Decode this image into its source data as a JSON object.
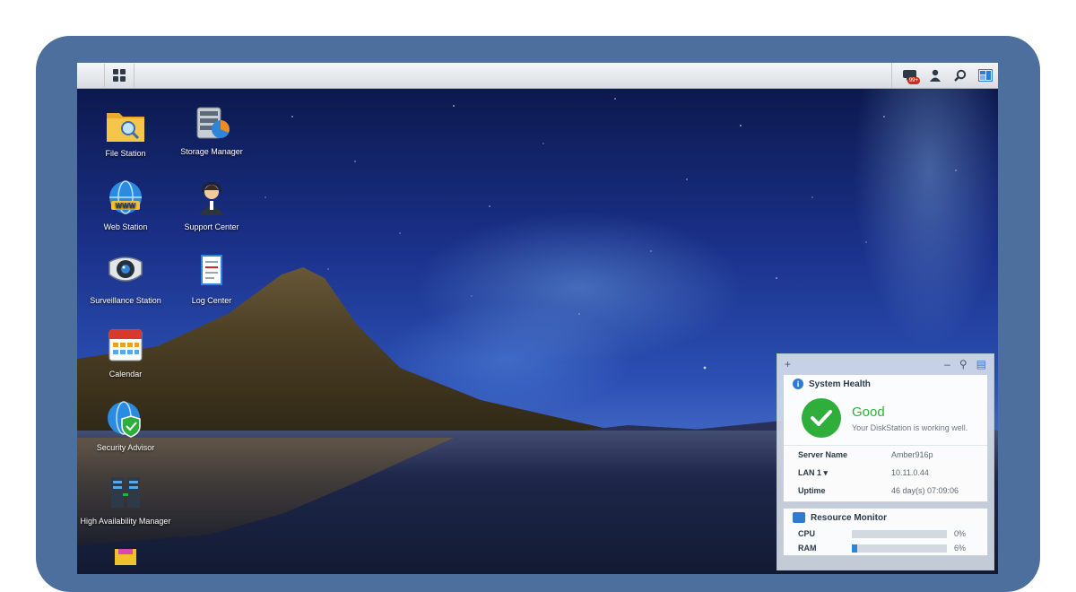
{
  "taskbar": {
    "main_menu_icon": "grid-icon",
    "right_icons": [
      "chat-notification-icon",
      "user-icon",
      "search-icon",
      "widgets-icon"
    ],
    "notification_badge": "99+"
  },
  "desktop": {
    "icons": [
      {
        "label": "File Station",
        "icon": "folder-search-icon"
      },
      {
        "label": "Storage Manager",
        "icon": "storage-icon"
      },
      {
        "label": "Web Station",
        "icon": "globe-icon"
      },
      {
        "label": "Support Center",
        "icon": "support-person-icon"
      },
      {
        "label": "Surveillance Station",
        "icon": "camera-icon"
      },
      {
        "label": "Log Center",
        "icon": "log-document-icon"
      },
      {
        "label": "Calendar",
        "icon": "calendar-icon"
      },
      {
        "label": "Security Advisor",
        "icon": "shield-globe-icon"
      },
      {
        "label": "High Availability Manager",
        "icon": "servers-icon"
      }
    ]
  },
  "widgets": {
    "system_health": {
      "title": "System Health",
      "status": "Good",
      "status_detail": "Your DiskStation is working well.",
      "rows": [
        {
          "key": "Server Name",
          "value": "Amber916p"
        },
        {
          "key": "LAN 1 ▾",
          "value": "10.11.0.44"
        },
        {
          "key": "Uptime",
          "value": "46 day(s) 07:09:06"
        }
      ]
    },
    "resource_monitor": {
      "title": "Resource Monitor",
      "rows": [
        {
          "key": "CPU",
          "value": "0%",
          "fraction": 0.0
        },
        {
          "key": "RAM",
          "value": "6%",
          "fraction": 0.06
        }
      ]
    }
  },
  "colors": {
    "frame": "#4c6f9e",
    "good_green": "#2fae3c",
    "accent_blue": "#2f86d8"
  }
}
